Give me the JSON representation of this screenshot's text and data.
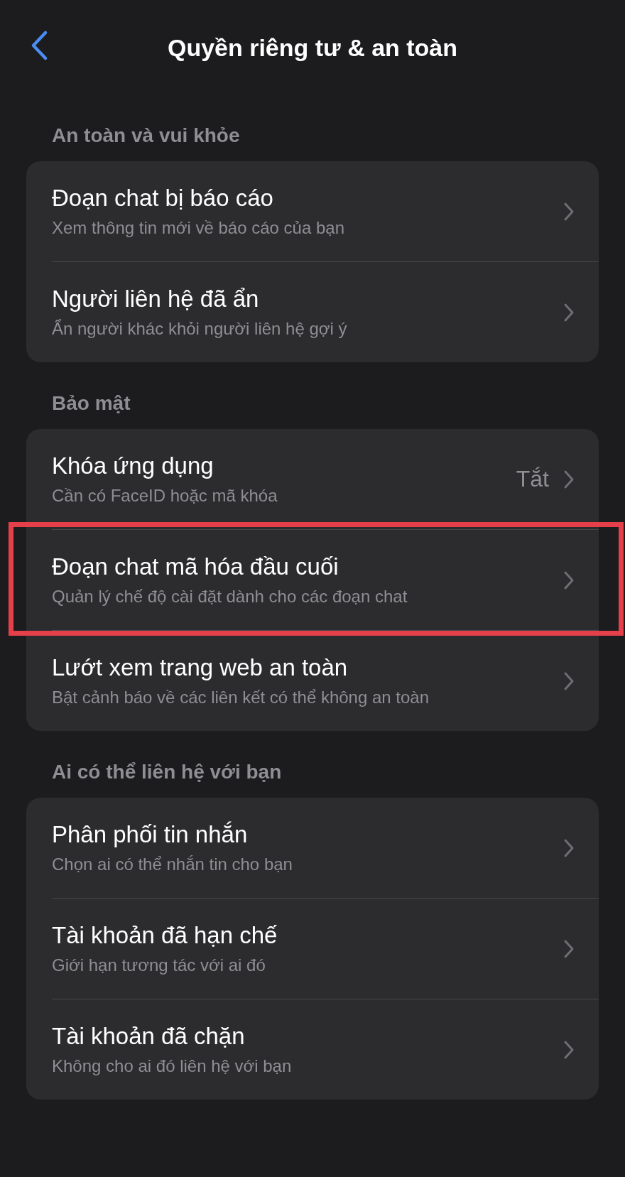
{
  "header": {
    "title": "Quyền riêng tư & an toàn"
  },
  "sections": [
    {
      "title": "An toàn và vui khỏe",
      "items": [
        {
          "title": "Đoạn chat bị báo cáo",
          "subtitle": "Xem thông tin mới về báo cáo của bạn",
          "highlighted": false
        },
        {
          "title": "Người liên hệ đã ẩn",
          "subtitle": "Ẩn người khác khỏi người liên hệ gợi ý",
          "highlighted": false
        }
      ]
    },
    {
      "title": "Bảo mật",
      "items": [
        {
          "title": "Khóa ứng dụng",
          "subtitle": "Cần có FaceID hoặc mã khóa",
          "value": "Tắt",
          "highlighted": false
        },
        {
          "title": "Đoạn chat mã hóa đầu cuối",
          "subtitle": "Quản lý chế độ cài đặt dành cho các đoạn chat",
          "highlighted": true
        },
        {
          "title": "Lướt xem trang web an toàn",
          "subtitle": "Bật cảnh báo về các liên kết có thể không an toàn",
          "highlighted": false
        }
      ]
    },
    {
      "title": "Ai có thể liên hệ với bạn",
      "items": [
        {
          "title": "Phân phối tin nhắn",
          "subtitle": "Chọn ai có thể nhắn tin cho bạn",
          "highlighted": false
        },
        {
          "title": "Tài khoản đã hạn chế",
          "subtitle": "Giới hạn tương tác với ai đó",
          "highlighted": false
        },
        {
          "title": "Tài khoản đã chặn",
          "subtitle": "Không cho ai đó liên hệ với bạn",
          "highlighted": false
        }
      ]
    }
  ]
}
